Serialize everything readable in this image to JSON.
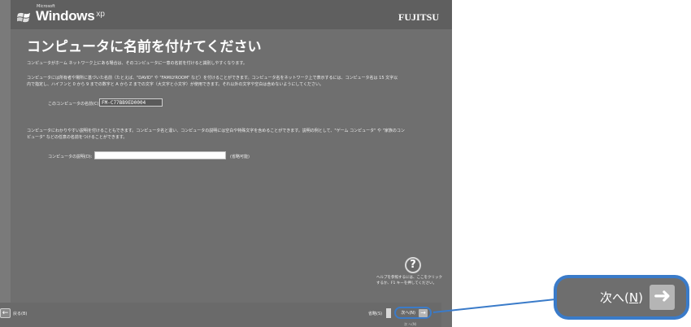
{
  "header": {
    "brand_small": "Microsoft",
    "windows": "Windows",
    "xp": "xp",
    "oem": "FUJITSU"
  },
  "title": "コンピュータに名前を付けてください",
  "paragraphs": {
    "p1": "コンピュータがホーム ネットワーク上にある場合は、そのコンピュータに一意の名前を付けると識別しやすくなります。",
    "p2a": "コンピュータには所有者や場所に基づいた名前（たとえば、\"DAVID\" や \"FAMILYROOM\" など）を付けることができます。コンピュータ名をネットワーク上で表示するには、コンピュータ名は 15 文字以",
    "p2b": "内で指定し、ハイフンと 0 から 9 までの数字と A から Z までの文字（大文字と小文字）が使用できます。それ以外の文字や空白は含めないようにしてください。",
    "p3a": "コンピュータにわかりやすい説明を付けることもできます。コンピュータ名と違い、コンピュータの説明には空白や特殊文字を含めることができます。説明の例として、\"ゲーム コンピュータ\" や \"家族のコン",
    "p3b": "ピュータ\" などの任意の名前をつけることができます。"
  },
  "form": {
    "name_label": "このコンピュータの名前(C):",
    "name_value": "FM-C77BB9ED0004",
    "desc_label": "コンピュータの説明(D):",
    "desc_value": "",
    "optional": "(省略可能)"
  },
  "help": {
    "icon": "?",
    "text_line1": "ヘルプを参照するには、ここをクリック",
    "text_line2": "するか、F1 キーを押してください。"
  },
  "nav": {
    "back_label": "戻る(B)",
    "skip_label": "省略(S)",
    "next_label": "次へ(N)",
    "under_text": "次 へ(N)"
  },
  "zoom": {
    "label_main": "次へ(",
    "label_key": "N",
    "label_end": ")"
  },
  "colors": {
    "accent": "#3a7bc9",
    "background": "#6f6f6f"
  }
}
